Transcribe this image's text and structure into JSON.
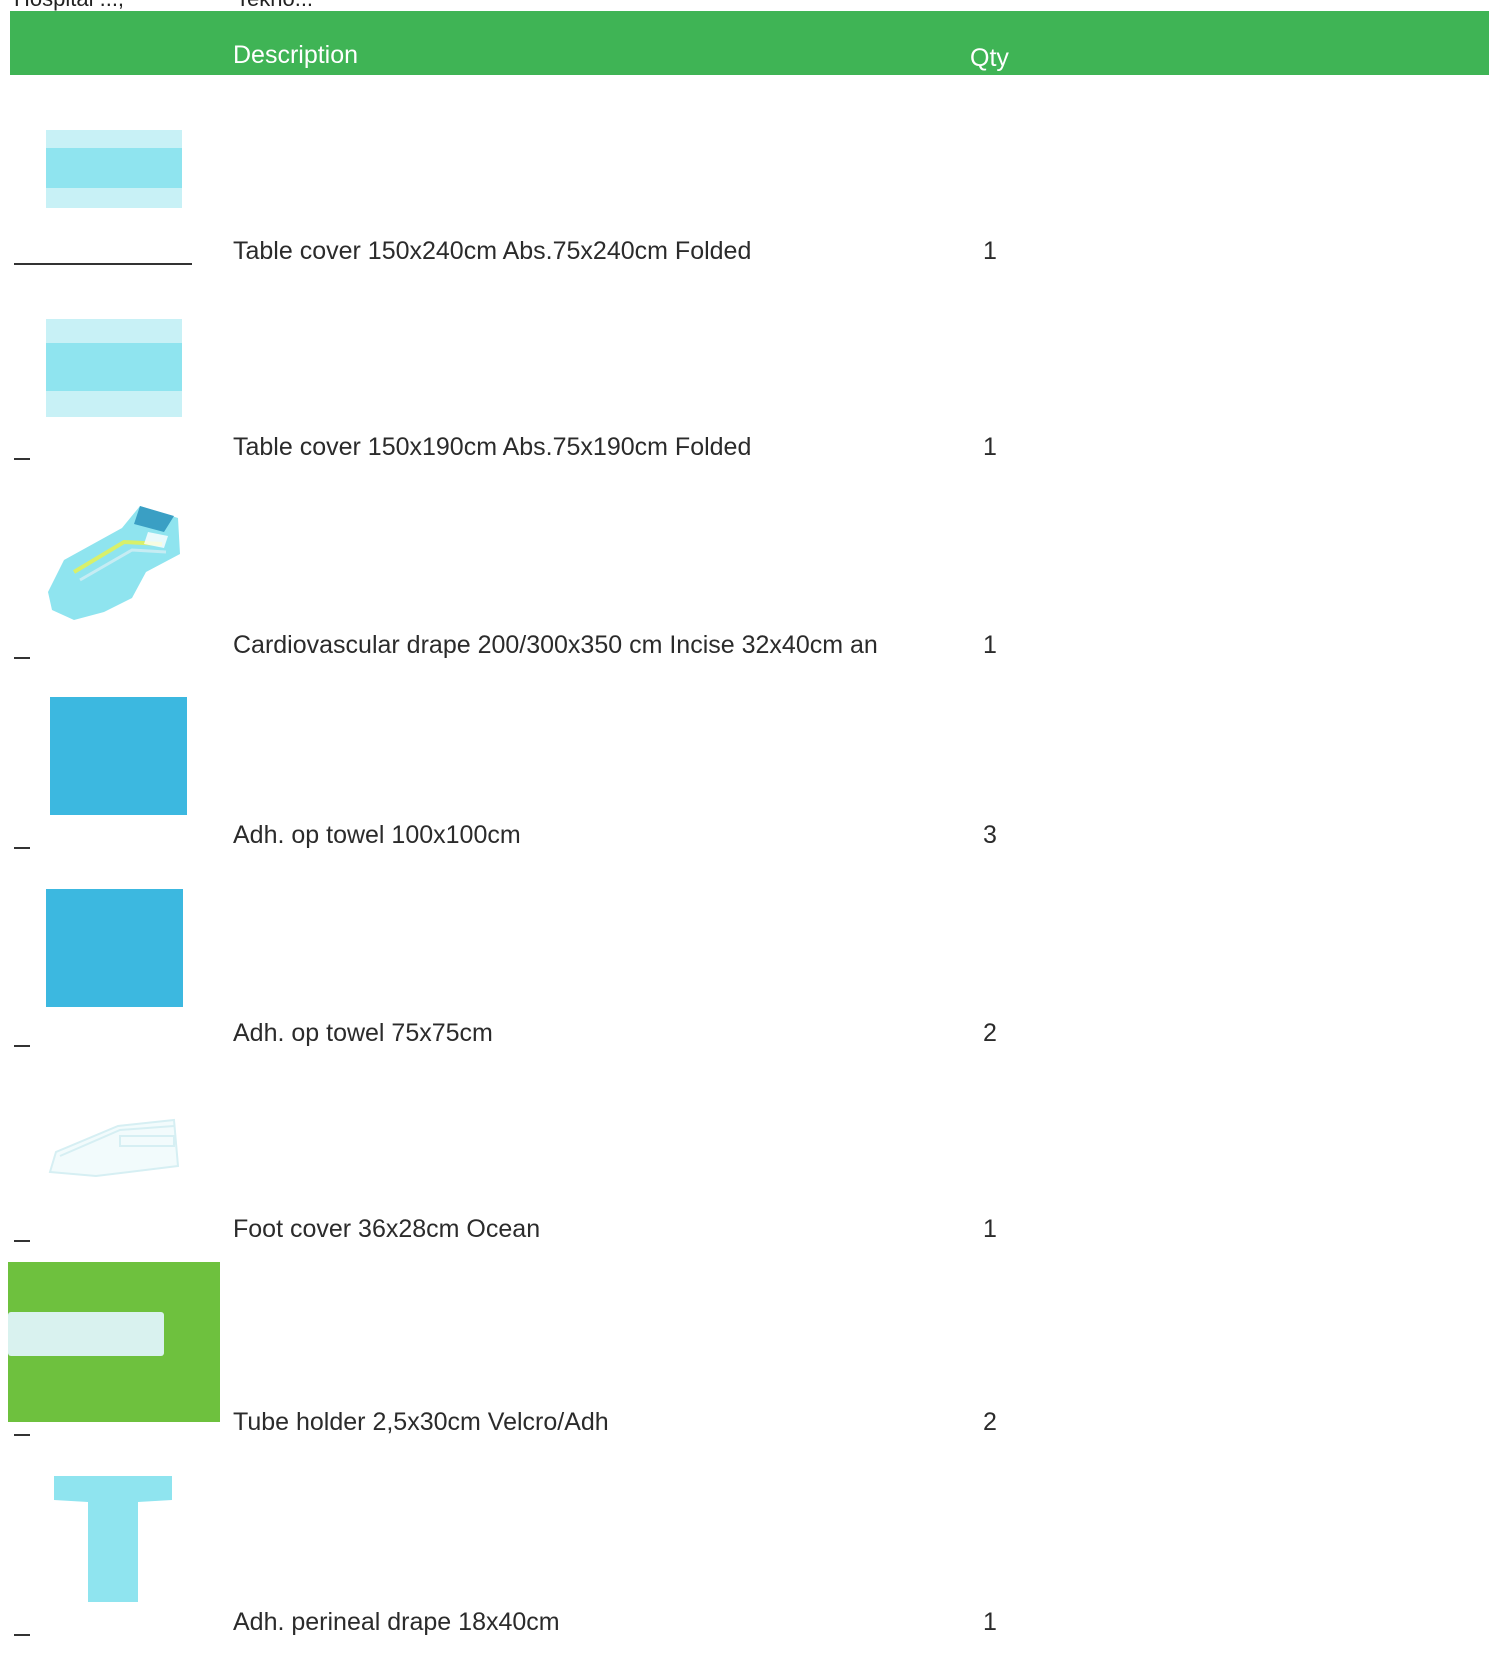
{
  "document": {
    "cut_top_left": "Hospital ..., ",
    "cut_top_right": "Tekno...",
    "colors": {
      "header": "#3fb455",
      "light_blue": "#8fe4ef",
      "blue": "#3cb8e0",
      "green": "#6ec13e"
    }
  },
  "table": {
    "headers": {
      "description": "Description",
      "qty": "Qty"
    },
    "rows": [
      {
        "description": "Table cover 150x240cm Abs.75x240cm Folded",
        "qty": "1",
        "icon": "table-cover-icon"
      },
      {
        "description": "Table cover 150x190cm Abs.75x190cm Folded",
        "qty": "1",
        "icon": "table-cover-icon"
      },
      {
        "description": "Cardiovascular drape 200/300x350 cm Incise 32x40cm an",
        "qty": "1",
        "icon": "cardiovascular-drape-icon"
      },
      {
        "description": "Adh. op towel 100x100cm",
        "qty": "3",
        "icon": "op-towel-icon"
      },
      {
        "description": "Adh. op towel 75x75cm",
        "qty": "2",
        "icon": "op-towel-icon"
      },
      {
        "description": "Foot cover 36x28cm Ocean",
        "qty": "1",
        "icon": "foot-cover-icon"
      },
      {
        "description": "Tube holder 2,5x30cm Velcro/Adh",
        "qty": "2",
        "icon": "tube-holder-icon"
      },
      {
        "description": "Adh. perineal drape 18x40cm",
        "qty": "1",
        "icon": "perineal-drape-icon"
      }
    ]
  }
}
